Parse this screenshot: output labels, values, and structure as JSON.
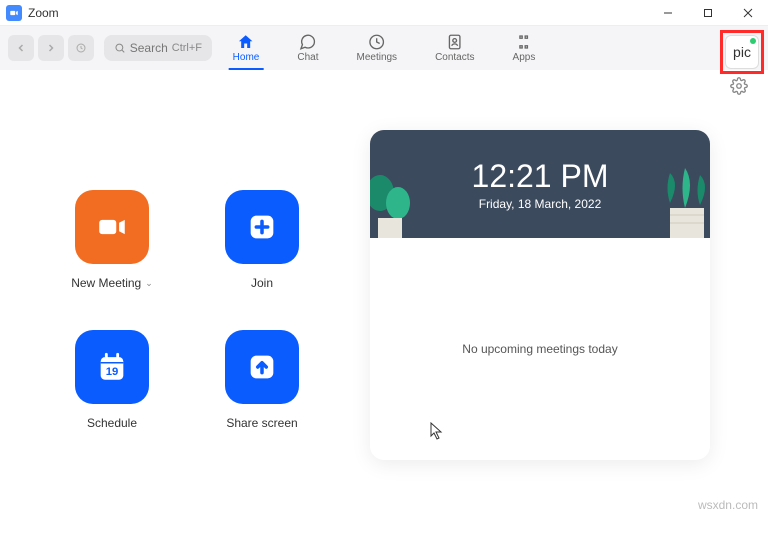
{
  "window": {
    "title": "Zoom"
  },
  "search": {
    "label": "Search",
    "shortcut": "Ctrl+F"
  },
  "tabs": {
    "home": "Home",
    "chat": "Chat",
    "meetings": "Meetings",
    "contacts": "Contacts",
    "apps": "Apps"
  },
  "profile": {
    "text": "pic"
  },
  "actions": {
    "new_meeting": "New Meeting",
    "join": "Join",
    "schedule": "Schedule",
    "share": "Share screen",
    "calendar_day": "19"
  },
  "calendar": {
    "time": "12:21 PM",
    "date": "Friday, 18 March, 2022",
    "empty": "No upcoming meetings today"
  },
  "watermark": "wsxdn.com"
}
